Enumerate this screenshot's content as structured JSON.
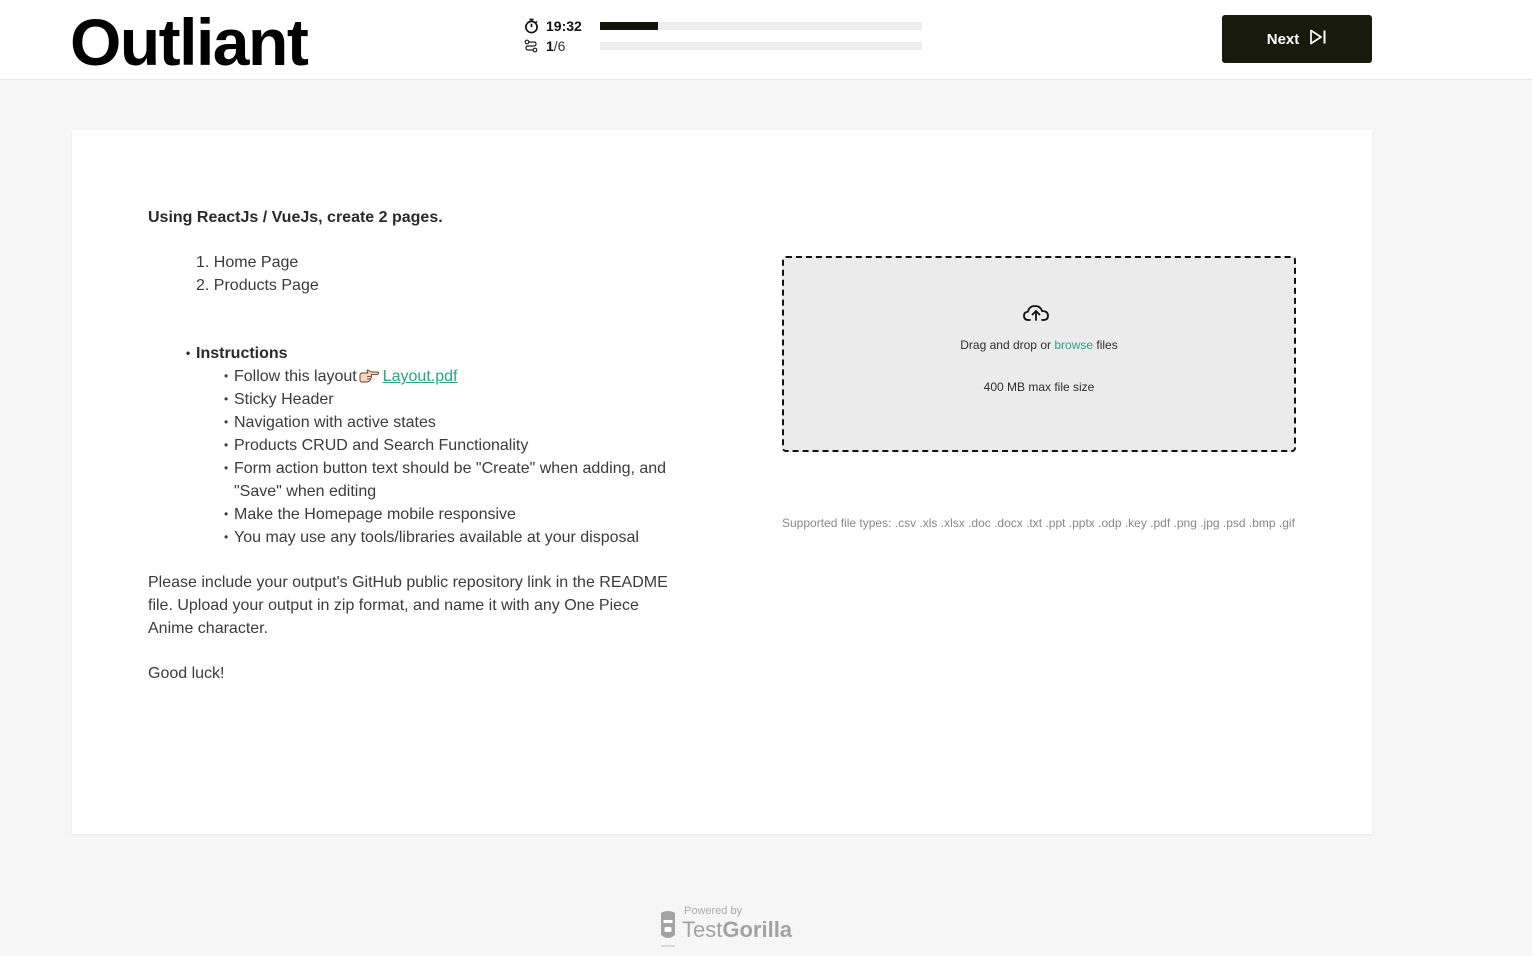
{
  "header": {
    "logo": "Outliant",
    "timer": "19:32",
    "timer_fraction": 0.18,
    "question_current": "1",
    "question_total": "/6",
    "question_fraction": 0.0,
    "next_label": "Next"
  },
  "question": {
    "title": "Using ReactJs / VueJs, create 2 pages.",
    "pages": [
      "1. Home Page",
      "2. Products Page"
    ],
    "instructions_heading": "Instructions",
    "follow_prefix": "Follow this layout",
    "layout_link": "Layout.pdf",
    "items": [
      "Sticky Header",
      "Navigation with active states",
      "Products CRUD and Search Functionality",
      "Form action button text should be \"Create\" when adding, and \"Save\" when editing",
      "Make the Homepage mobile responsive",
      "You may use any tools/libraries available at your disposal"
    ],
    "paragraph": "Please include your output's GitHub public repository link in the README file. Upload your output in zip format, and name it with any One Piece Anime character.",
    "closing": "Good luck!"
  },
  "upload": {
    "drag_prefix": "Drag and drop or",
    "browse": "browse",
    "drag_suffix": "files",
    "max_size": "400 MB max file size",
    "supported": "Supported file types: .csv .xls .xlsx .doc .docx .txt .ppt .pptx .odp .key .pdf .png .jpg .psd .bmp .gif"
  },
  "footer": {
    "powered_by": "Powered by",
    "brand_light": "Test",
    "brand_bold": "Gorilla"
  },
  "colors": {
    "accent": "#2aa28b",
    "button_bg": "#181a0b",
    "progress_fill": "#13150a"
  },
  "icons": {
    "timer": "stopwatch-icon",
    "questions": "question-route-icon",
    "next": "skip-forward-icon",
    "upload": "cloud-upload-icon",
    "pointer": "pointing-hand-icon",
    "brand": "gorilla-logo-icon"
  }
}
